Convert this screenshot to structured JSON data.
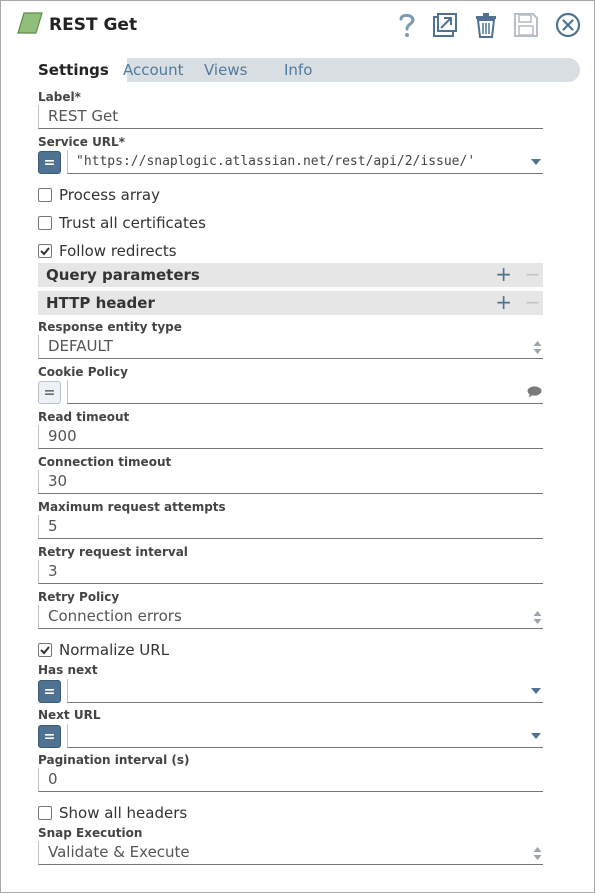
{
  "header": {
    "title": "REST Get",
    "buttons": {
      "help": "help-icon",
      "export": "export-icon",
      "delete": "trash-icon",
      "save": "save-icon",
      "close": "close-icon"
    }
  },
  "tabs": [
    {
      "label": "Settings",
      "active": true
    },
    {
      "label": "Account",
      "active": false
    },
    {
      "label": "Views",
      "active": false
    },
    {
      "label": "Info",
      "active": false
    }
  ],
  "fields": {
    "label": {
      "label": "Label*",
      "value": "REST Get"
    },
    "service_url": {
      "label": "Service URL*",
      "value": "\"https://snaplogic.atlassian.net/rest/api/2/issue/'"
    },
    "process_array": {
      "label": "Process array",
      "checked": false
    },
    "trust_all": {
      "label": "Trust all certificates",
      "checked": false
    },
    "follow_redirects": {
      "label": "Follow redirects",
      "checked": true
    },
    "query_params": {
      "label": "Query parameters"
    },
    "http_header": {
      "label": "HTTP header"
    },
    "response_entity_type": {
      "label": "Response entity type",
      "value": "DEFAULT"
    },
    "cookie_policy": {
      "label": "Cookie Policy",
      "value": ""
    },
    "read_timeout": {
      "label": "Read timeout",
      "value": "900"
    },
    "connection_timeout": {
      "label": "Connection timeout",
      "value": "30"
    },
    "max_attempts": {
      "label": "Maximum request attempts",
      "value": "5"
    },
    "retry_interval": {
      "label": "Retry request interval",
      "value": "3"
    },
    "retry_policy": {
      "label": "Retry Policy",
      "value": "Connection errors"
    },
    "normalize_url": {
      "label": "Normalize URL",
      "checked": true
    },
    "has_next": {
      "label": "Has next",
      "value": ""
    },
    "next_url": {
      "label": "Next URL",
      "value": ""
    },
    "pagination_interval": {
      "label": "Pagination interval (s)",
      "value": "0"
    },
    "show_all_headers": {
      "label": "Show all headers",
      "checked": false
    },
    "snap_execution": {
      "label": "Snap Execution",
      "value": "Validate & Execute"
    }
  },
  "expr_symbol": "=",
  "colors": {
    "accent": "#4f7293",
    "tab_bar": "#d9dee2",
    "section_bg": "#e6e6e6",
    "snap_icon": "#8fbf7a"
  }
}
